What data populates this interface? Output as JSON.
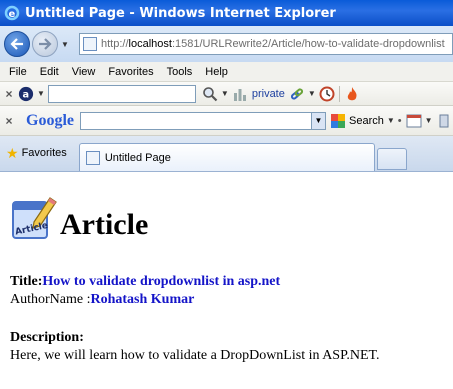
{
  "window": {
    "title": "Untitled Page - Windows Internet Explorer"
  },
  "address": {
    "url_prefix": "http://",
    "url_host": "localhost",
    "url_rest": ":1581/URLRewrite2/Article/how-to-validate-dropdownlist"
  },
  "menu": [
    "File",
    "Edit",
    "View",
    "Favorites",
    "Tools",
    "Help"
  ],
  "toolbar1": {
    "private_label": "private"
  },
  "toolbar2": {
    "google_label": "Google",
    "search_label": "Search"
  },
  "tabs": {
    "favorites_label": "Favorites",
    "active_tab_label": "Untitled Page"
  },
  "page": {
    "heading": "Article",
    "icon_text": "Article",
    "title_label": "Title:",
    "title_value": "How to validate dropdownlist in asp.net",
    "author_label": "AuthorName :",
    "author_value": "Rohatash Kumar",
    "description_label": "Description:",
    "description_value": "Here, we will learn how to validate a DropDownList in ASP.NET."
  },
  "colors": {
    "link_blue": "#1414c8",
    "titlebar_blue": "#0a5bd8"
  }
}
